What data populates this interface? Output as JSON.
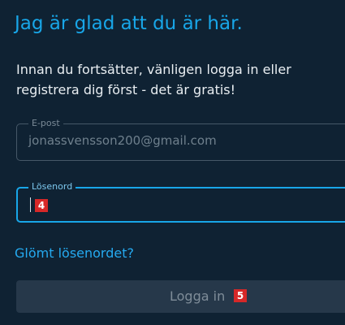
{
  "heading": "Jag är glad att du är här.",
  "intro": "Innan du fortsätter, vänligen logga in eller registrera dig först - det är gratis!",
  "email_field": {
    "label": "E-post",
    "value": "jonassvensson200@gmail.com"
  },
  "password_field": {
    "label": "Lösenord",
    "value": "",
    "badge": "4"
  },
  "forgot_password_link": "Glömt lösenordet?",
  "login_button": {
    "label": "Logga in",
    "badge": "5"
  },
  "colors": {
    "background": "#0f2233",
    "accent": "#18a6e8",
    "badge": "#d62828",
    "button": "#26384a"
  }
}
